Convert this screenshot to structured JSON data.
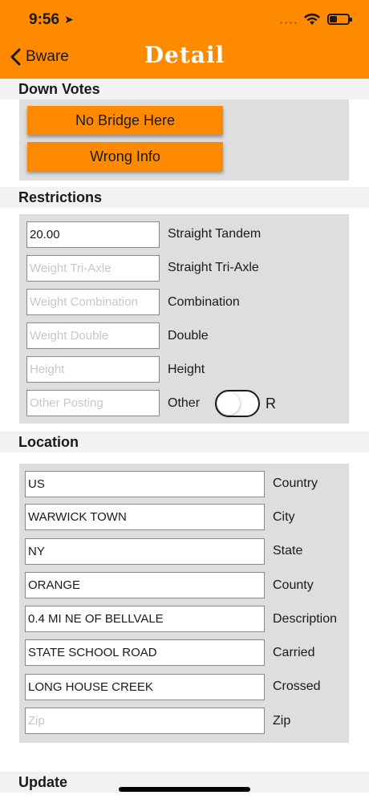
{
  "status": {
    "time": "9:56",
    "location_glyph": "➤"
  },
  "nav": {
    "back_label": "Bware",
    "title": "Detail"
  },
  "down_votes": {
    "header": "Down Votes",
    "buttons": [
      "No Bridge Here",
      "Wrong Info"
    ]
  },
  "restrictions": {
    "header": "Restrictions",
    "rows": [
      {
        "value": "20.00",
        "placeholder": "",
        "label": "Straight Tandem"
      },
      {
        "value": "",
        "placeholder": "Weight Tri-Axle",
        "label": "Straight Tri-Axle"
      },
      {
        "value": "",
        "placeholder": "Weight Combination",
        "label": "Combination"
      },
      {
        "value": "",
        "placeholder": "Weight Double",
        "label": "Double"
      },
      {
        "value": "",
        "placeholder": "Height",
        "label": "Height"
      },
      {
        "value": "",
        "placeholder": "Other Posting",
        "label": "Other"
      }
    ],
    "toggle_suffix": "R",
    "toggle_on": false
  },
  "location": {
    "header": "Location",
    "rows": [
      {
        "value": "US",
        "placeholder": "",
        "label": "Country"
      },
      {
        "value": "WARWICK TOWN",
        "placeholder": "",
        "label": "City"
      },
      {
        "value": "NY",
        "placeholder": "",
        "label": "State"
      },
      {
        "value": "ORANGE",
        "placeholder": "",
        "label": "County"
      },
      {
        "value": "0.4 MI NE OF BELLVALE",
        "placeholder": "",
        "label": "Description"
      },
      {
        "value": "STATE SCHOOL ROAD",
        "placeholder": "",
        "label": "Carried"
      },
      {
        "value": "LONG HOUSE CREEK",
        "placeholder": "",
        "label": "Crossed"
      },
      {
        "value": "",
        "placeholder": "Zip",
        "label": "Zip"
      }
    ]
  },
  "update": {
    "header": "Update"
  },
  "colors": {
    "accent": "#ff8a00",
    "panel": "#dedede",
    "section": "#f2f2f2"
  }
}
